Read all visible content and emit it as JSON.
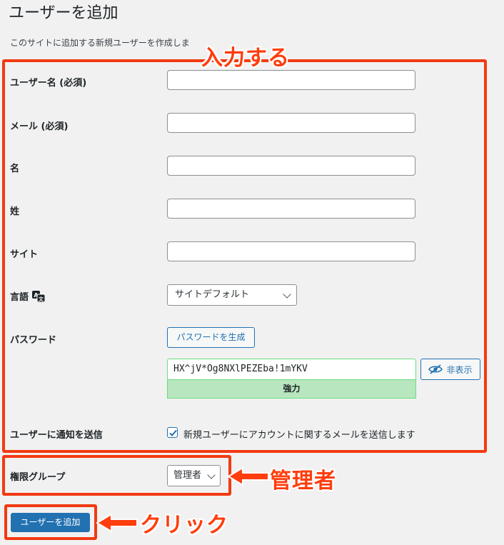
{
  "page": {
    "title": "ユーザーを追加",
    "description": "このサイトに追加する新規ユーザーを作成しま"
  },
  "form": {
    "username": {
      "label": "ユーザー名 (必須)",
      "value": ""
    },
    "email": {
      "label": "メール (必須)",
      "value": ""
    },
    "first_name": {
      "label": "名",
      "value": ""
    },
    "last_name": {
      "label": "姓",
      "value": ""
    },
    "website": {
      "label": "サイト",
      "value": ""
    },
    "language": {
      "label": "言語",
      "selected": "サイトデフォルト",
      "icon": "translate-icon"
    },
    "password": {
      "label": "パスワード",
      "generate_label": "パスワードを生成",
      "value": "HX^jV*Og8NXlPEZEba!1mYKV",
      "hide_label": "非表示",
      "strength": "強力",
      "strength_color": "#b8e6bf"
    },
    "notify": {
      "label": "ユーザーに通知を送信",
      "checkbox_label": "新規ユーザーにアカウントに関するメールを送信します",
      "checked": true
    },
    "role": {
      "label": "権限グループ",
      "selected": "管理者"
    },
    "submit_label": "ユーザーを追加"
  },
  "annotations": {
    "input_callout": "入力する",
    "role_callout": "管理者",
    "click_callout": "クリック",
    "color": "#f23a12"
  },
  "colors": {
    "accent": "#2271b1",
    "background": "#f1f1f1"
  }
}
